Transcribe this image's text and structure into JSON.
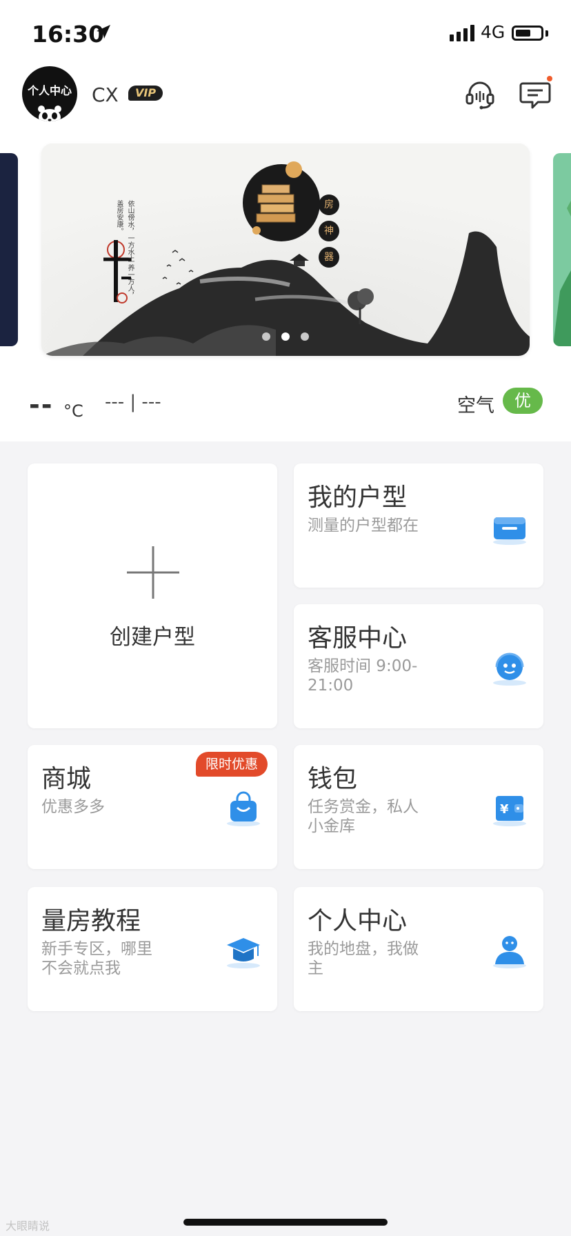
{
  "status_bar": {
    "time": "16:30",
    "network": "4G",
    "battery_level": 0.62
  },
  "header": {
    "avatar_text": "个人中心",
    "username": "CX",
    "vip": "VIP",
    "icons": [
      "customer-service-icon",
      "message-icon"
    ]
  },
  "banner": {
    "title_chars": [
      "房",
      "神",
      "器"
    ],
    "poem": "依山傍水，一方水土 养一方人，盖房安康。",
    "page_count": 3,
    "active_page": 2
  },
  "weather": {
    "temperature": "--",
    "temperature_unit": "°C",
    "description": "--- | ---",
    "air_label": "空气",
    "air_quality": "优"
  },
  "tiles": {
    "create": {
      "label": "创建户型"
    },
    "my_house": {
      "title": "我的户型",
      "subtitle": "测量的户型都在"
    },
    "service": {
      "title": "客服中心",
      "subtitle": "客服时间 9:00-21:00"
    },
    "mall": {
      "title": "商城",
      "subtitle": "优惠多多",
      "badge": "限时优惠"
    },
    "wallet": {
      "title": "钱包",
      "subtitle": "任务赏金，私人小金库"
    },
    "tutorial": {
      "title": "量房教程",
      "subtitle": "新手专区，哪里不会就点我"
    },
    "profile": {
      "title": "个人中心",
      "subtitle": "我的地盘，我做主"
    }
  },
  "colors": {
    "accent_blue": "#2f8fe8",
    "air_green": "#66b94a",
    "promo_red": "#e24a2a",
    "vip_gold": "#e7c478"
  },
  "watermark": "大眼睛说"
}
